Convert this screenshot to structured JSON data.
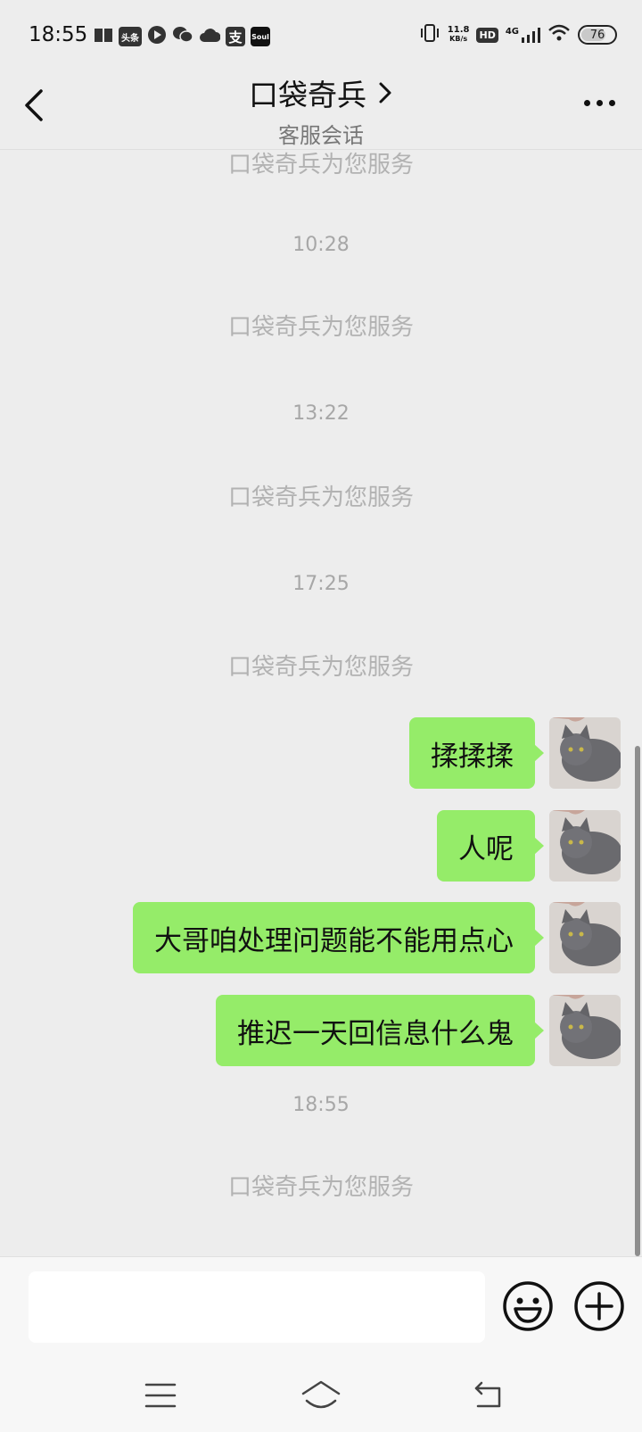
{
  "status_bar": {
    "time": "18:55",
    "app_icons": [
      "book-icon",
      "toutiao-icon",
      "play-icon",
      "wechat-icon",
      "cloud-icon",
      "alipay-icon",
      "soul-icon"
    ],
    "toutiao_label": "头条",
    "alipay_label": "支",
    "soul_label": "Soul",
    "net_speed_value": "11.8",
    "net_speed_unit": "KB/s",
    "hd_label": "HD",
    "network_label": "4G",
    "battery_level": "76"
  },
  "header": {
    "title": "口袋奇兵",
    "subtitle": "客服会话"
  },
  "chat": {
    "system_message": "口袋奇兵为您服务",
    "timestamps": [
      "10:28",
      "13:22",
      "17:25",
      "18:55"
    ],
    "messages": [
      {
        "text": "揉揉揉",
        "sender": "me"
      },
      {
        "text": "人呢",
        "sender": "me"
      },
      {
        "text": "大哥咱处理问题能不能用点心",
        "sender": "me"
      },
      {
        "text": "推迟一天回信息什么鬼",
        "sender": "me"
      }
    ]
  },
  "input": {
    "value": ""
  },
  "colors": {
    "bubble": "#95ec69",
    "background": "#ededed",
    "system_text": "#b2b2b2"
  }
}
